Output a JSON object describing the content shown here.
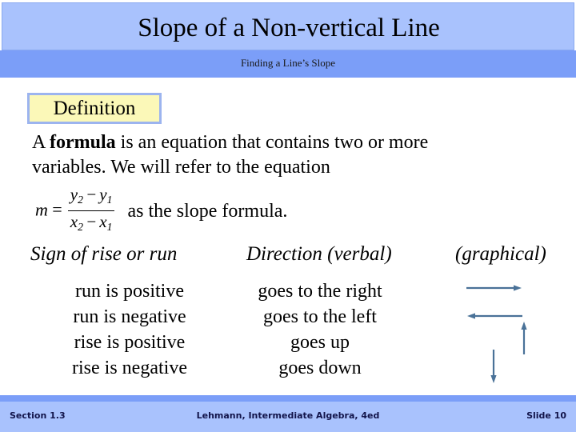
{
  "header": {
    "title": "Slope of a Non-vertical Line",
    "subtitle": "Finding a Line’s Slope"
  },
  "definition": {
    "label": "Definition",
    "paragraph_line1_prefix": "A ",
    "paragraph_bold": "formula",
    "paragraph_line1_suffix": " is an equation that contains two or more",
    "paragraph_line2": "variables.  We will refer to the equation"
  },
  "formula": {
    "lhs": "m",
    "equals": "=",
    "numerator_y2": "y",
    "numerator_y2_sub": "2",
    "numerator_minus": "−",
    "numerator_y1": "y",
    "numerator_y1_sub": "1",
    "denominator_x2": "x",
    "denominator_x2_sub": "2",
    "denominator_minus": "−",
    "denominator_x1": "x",
    "denominator_x1_sub": "1",
    "tail_text": "as the slope formula."
  },
  "table": {
    "headers": {
      "sign": "Sign of rise or run",
      "direction": "Direction (verbal)",
      "graphical": "(graphical)"
    },
    "rows": [
      {
        "sign": "run is positive",
        "direction": "goes to the right",
        "graphical_icon": "arrow-right-icon"
      },
      {
        "sign": "run is negative",
        "direction": "goes to the left",
        "graphical_icon": "arrow-left-icon"
      },
      {
        "sign": "rise is positive",
        "direction": "goes up",
        "graphical_icon": "arrow-up-icon"
      },
      {
        "sign": "rise is negative",
        "direction": "goes down",
        "graphical_icon": "arrow-down-icon"
      }
    ]
  },
  "footer": {
    "section": "Section 1.3",
    "citation": "Lehmann, Intermediate Algebra, 4ed",
    "slide": "Slide 10"
  },
  "colors": {
    "title_band": "#a9c2fd",
    "subtitle_band": "#7b9ef8",
    "definition_fill": "#fbf8b8",
    "definition_border": "#9cb4ef",
    "arrow": "#4a7298",
    "footer_band": "#a9c2fd",
    "footer_text": "#12144a"
  }
}
